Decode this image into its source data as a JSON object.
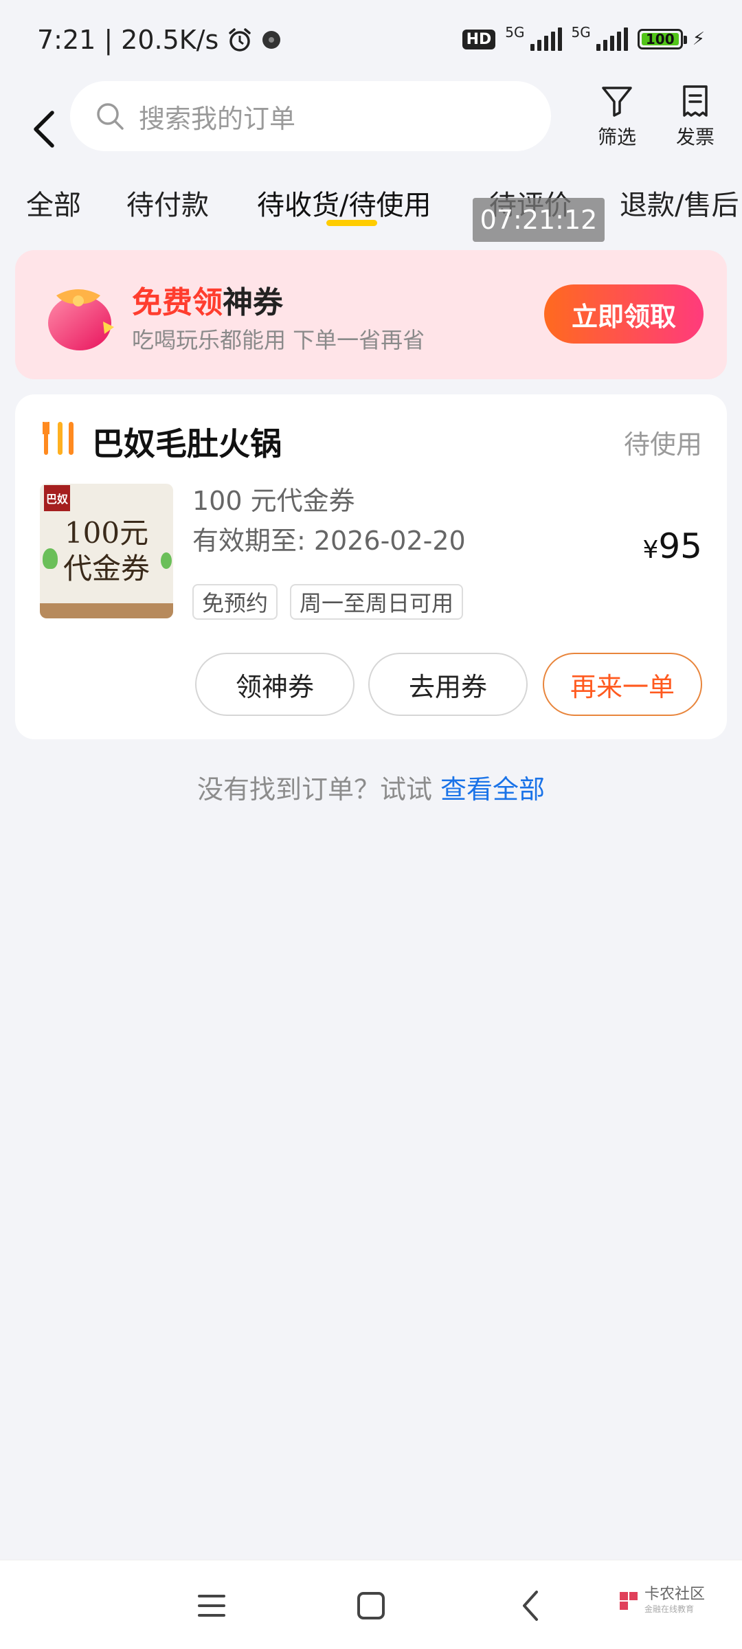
{
  "status_bar": {
    "time": "7:21",
    "speed": "20.5K/s",
    "hd": "HD",
    "net1": "5G",
    "net2": "5G",
    "battery": "100"
  },
  "header": {
    "search_placeholder": "搜索我的订单",
    "filter_label": "筛选",
    "invoice_label": "发票"
  },
  "tabs": [
    {
      "label": "全部"
    },
    {
      "label": "待付款"
    },
    {
      "label": "待收货/待使用"
    },
    {
      "label": "待评价"
    },
    {
      "label": "退款/售后"
    }
  ],
  "active_tab": "待收货/待使用",
  "time_overlay": "07:21:12",
  "promo": {
    "title_highlight": "免费领",
    "title_rest": "神券",
    "subtitle": "吃喝玩乐都能用 下单一省再省",
    "button": "立即领取"
  },
  "order": {
    "store_name": "巴奴毛肚火锅",
    "status": "待使用",
    "thumb_logo": "巴奴",
    "thumb_line1": "100元",
    "thumb_line2": "代金券",
    "product_name": "100 元代金券",
    "valid_until": "有效期至: 2026-02-20",
    "price_symbol": "¥",
    "price": "95",
    "tags": [
      "免预约",
      "周一至周日可用"
    ],
    "actions": [
      "领神券",
      "去用券",
      "再来一单"
    ]
  },
  "hint": {
    "text": "没有找到订单？试试",
    "link": "查看全部"
  },
  "watermark": {
    "name": "卡农社区",
    "sub": "金融在线教育"
  },
  "colors": {
    "accent_orange": "#ff5a1f",
    "promo_red": "#ff3d2e",
    "link_blue": "#1a73e8",
    "tab_underline": "#ffcc00"
  }
}
